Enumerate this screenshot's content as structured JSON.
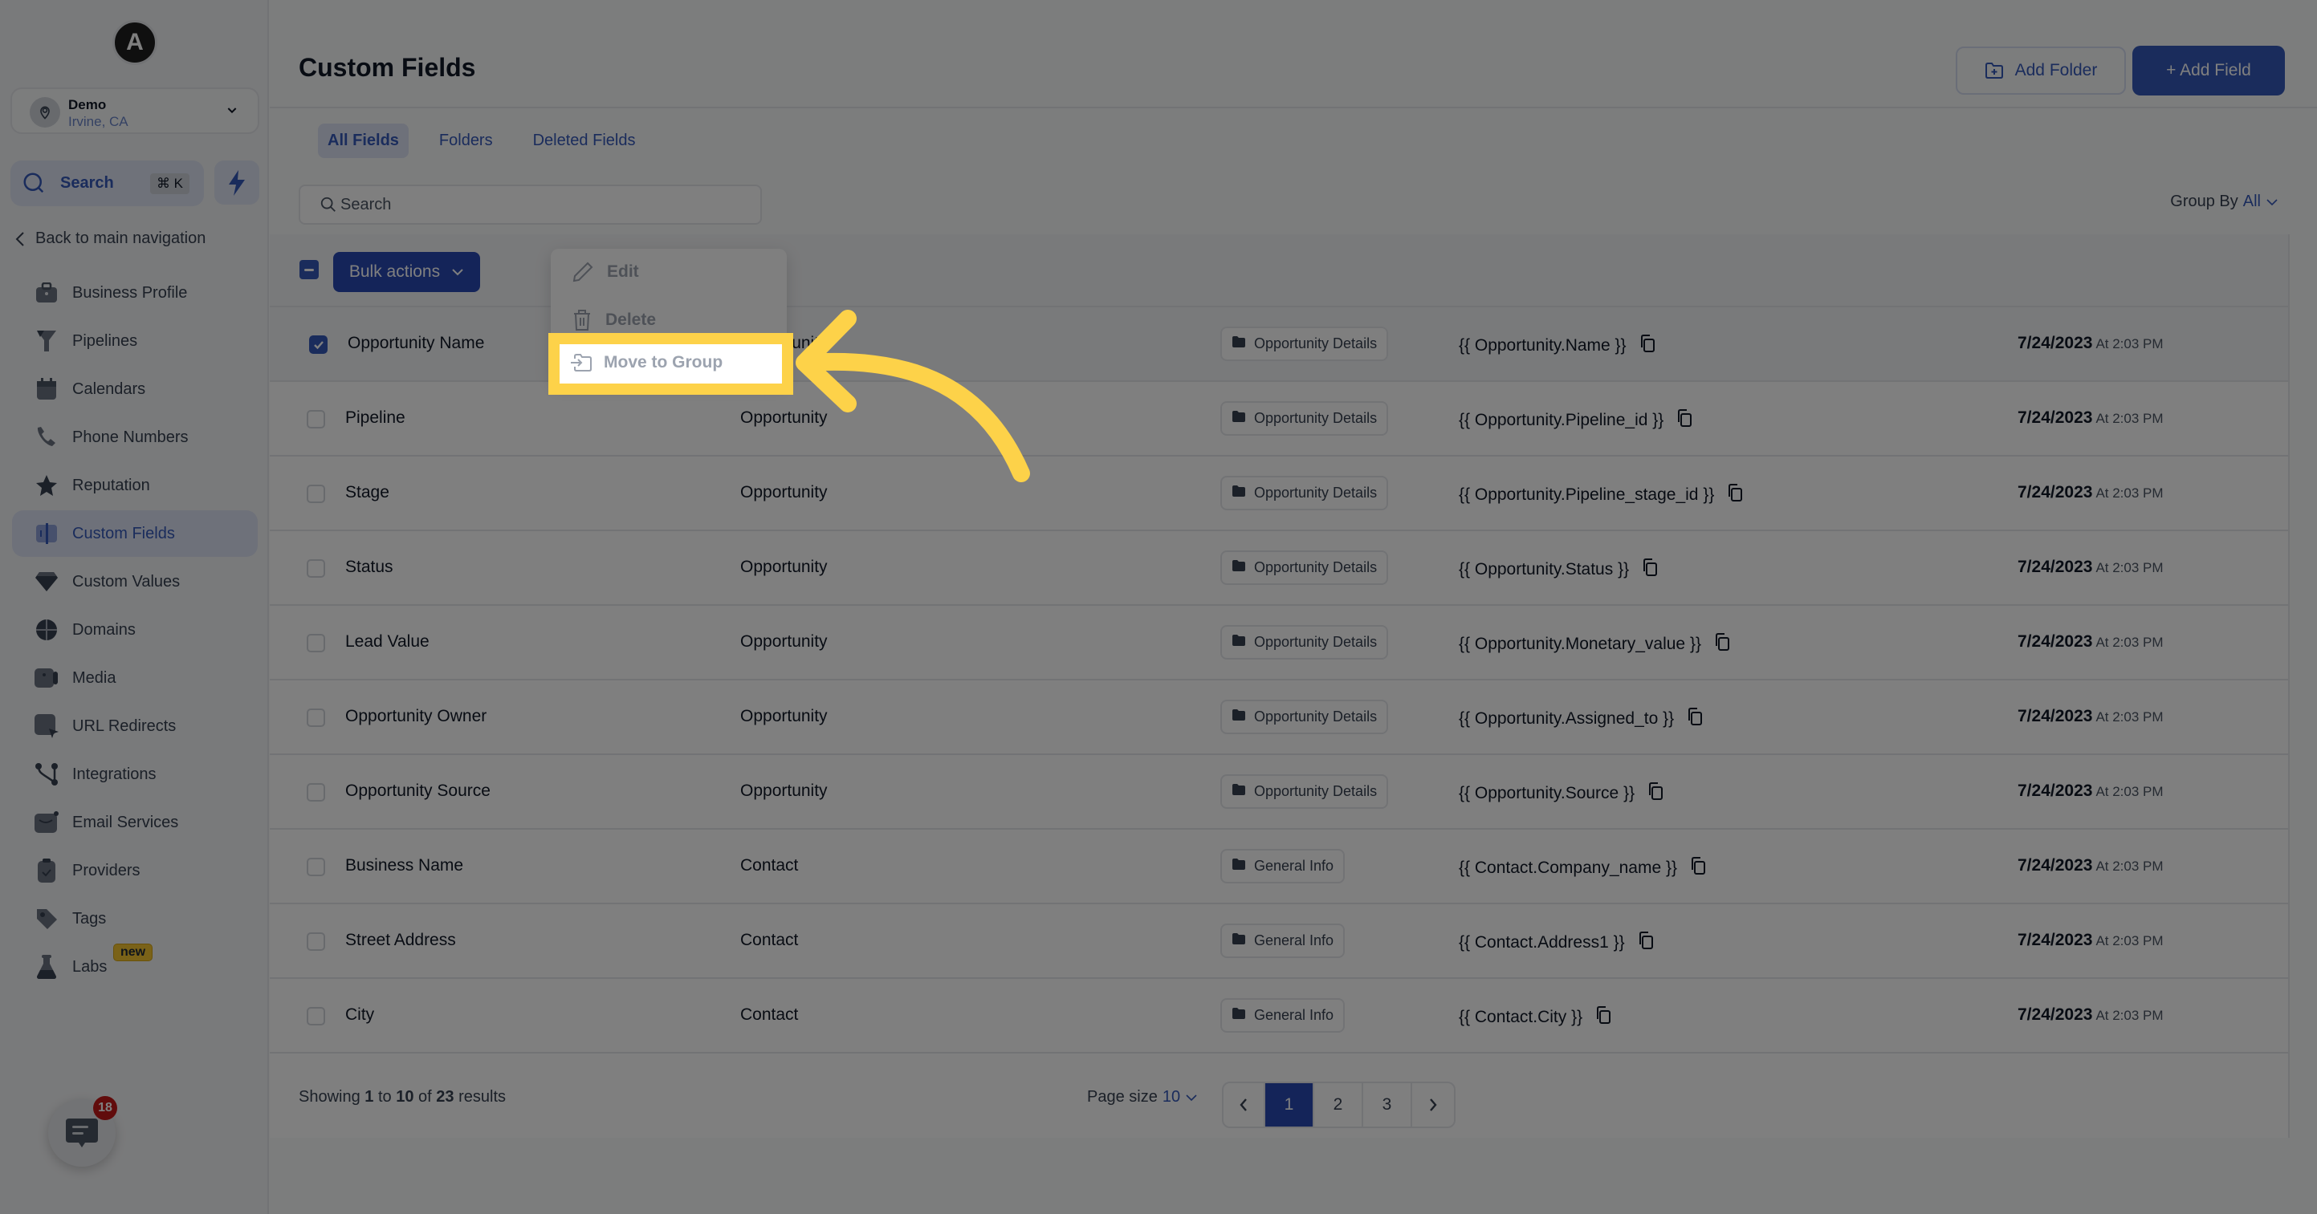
{
  "sidebar": {
    "logo_letter": "A",
    "location": {
      "name": "Demo",
      "city": "Irvine, CA"
    },
    "search": {
      "label": "Search",
      "shortcut": "⌘ K"
    },
    "back_label": "Back to main navigation",
    "items": [
      {
        "label": "Business Profile",
        "icon": "briefcase-icon"
      },
      {
        "label": "Pipelines",
        "icon": "funnel-icon"
      },
      {
        "label": "Calendars",
        "icon": "calendar-icon"
      },
      {
        "label": "Phone Numbers",
        "icon": "phone-icon"
      },
      {
        "label": "Reputation",
        "icon": "star-icon"
      },
      {
        "label": "Custom Fields",
        "icon": "custom-fields-icon",
        "active": true
      },
      {
        "label": "Custom Values",
        "icon": "gem-icon"
      },
      {
        "label": "Domains",
        "icon": "globe-icon"
      },
      {
        "label": "Media",
        "icon": "video-icon"
      },
      {
        "label": "URL Redirects",
        "icon": "redirect-icon"
      },
      {
        "label": "Integrations",
        "icon": "integrations-icon"
      },
      {
        "label": "Email Services",
        "icon": "mail-icon"
      },
      {
        "label": "Providers",
        "icon": "clipboard-icon"
      },
      {
        "label": "Tags",
        "icon": "tag-icon"
      },
      {
        "label": "Labs",
        "icon": "flask-icon",
        "badge": "new"
      }
    ],
    "chat_count": "18"
  },
  "header": {
    "title": "Custom Fields",
    "add_folder_label": "Add Folder",
    "add_field_label": "+ Add Field"
  },
  "tabs": [
    {
      "label": "All Fields",
      "active": true
    },
    {
      "label": "Folders"
    },
    {
      "label": "Deleted Fields"
    }
  ],
  "search": {
    "placeholder": "Search",
    "value": ""
  },
  "group_by": {
    "label": "Group By",
    "value": "All"
  },
  "bulk": {
    "label": "Bulk actions",
    "menu": [
      {
        "label": "Edit",
        "icon": "pencil-icon"
      },
      {
        "label": "Delete",
        "icon": "trash-icon"
      },
      {
        "label": "Move to Group",
        "icon": "move-folder-icon",
        "highlighted": true
      }
    ]
  },
  "rows": [
    {
      "name": "Opportunity Name",
      "model": "Opportunity",
      "folder": "Opportunity Details",
      "key": "{{ Opportunity.Name }}",
      "date": "7/24/2023",
      "time": "At 2:03 PM",
      "checked": true
    },
    {
      "name": "Pipeline",
      "model": "Opportunity",
      "folder": "Opportunity Details",
      "key": "{{ Opportunity.Pipeline_id }}",
      "date": "7/24/2023",
      "time": "At 2:03 PM",
      "checked": false
    },
    {
      "name": "Stage",
      "model": "Opportunity",
      "folder": "Opportunity Details",
      "key": "{{ Opportunity.Pipeline_stage_id }}",
      "date": "7/24/2023",
      "time": "At 2:03 PM",
      "checked": false
    },
    {
      "name": "Status",
      "model": "Opportunity",
      "folder": "Opportunity Details",
      "key": "{{ Opportunity.Status }}",
      "date": "7/24/2023",
      "time": "At 2:03 PM",
      "checked": false
    },
    {
      "name": "Lead Value",
      "model": "Opportunity",
      "folder": "Opportunity Details",
      "key": "{{ Opportunity.Monetary_value }}",
      "date": "7/24/2023",
      "time": "At 2:03 PM",
      "checked": false
    },
    {
      "name": "Opportunity Owner",
      "model": "Opportunity",
      "folder": "Opportunity Details",
      "key": "{{ Opportunity.Assigned_to }}",
      "date": "7/24/2023",
      "time": "At 2:03 PM",
      "checked": false
    },
    {
      "name": "Opportunity Source",
      "model": "Opportunity",
      "folder": "Opportunity Details",
      "key": "{{ Opportunity.Source }}",
      "date": "7/24/2023",
      "time": "At 2:03 PM",
      "checked": false
    },
    {
      "name": "Business Name",
      "model": "Contact",
      "folder": "General Info",
      "key": "{{ Contact.Company_name }}",
      "date": "7/24/2023",
      "time": "At 2:03 PM",
      "checked": false
    },
    {
      "name": "Street Address",
      "model": "Contact",
      "folder": "General Info",
      "key": "{{ Contact.Address1 }}",
      "date": "7/24/2023",
      "time": "At 2:03 PM",
      "checked": false
    },
    {
      "name": "City",
      "model": "Contact",
      "folder": "General Info",
      "key": "{{ Contact.City }}",
      "date": "7/24/2023",
      "time": "At 2:03 PM",
      "checked": false
    }
  ],
  "footer": {
    "showing_prefix": "Showing",
    "from": "1",
    "to_word": "to",
    "to": "10",
    "of_word": "of",
    "total": "23",
    "suffix": "results",
    "page_size_label": "Page size",
    "page_size": "10",
    "pages": [
      "1",
      "2",
      "3"
    ],
    "current_page": "1"
  },
  "colors": {
    "accent": "#3558b8",
    "highlight": "#fdd249",
    "badge_red": "#c21818"
  }
}
